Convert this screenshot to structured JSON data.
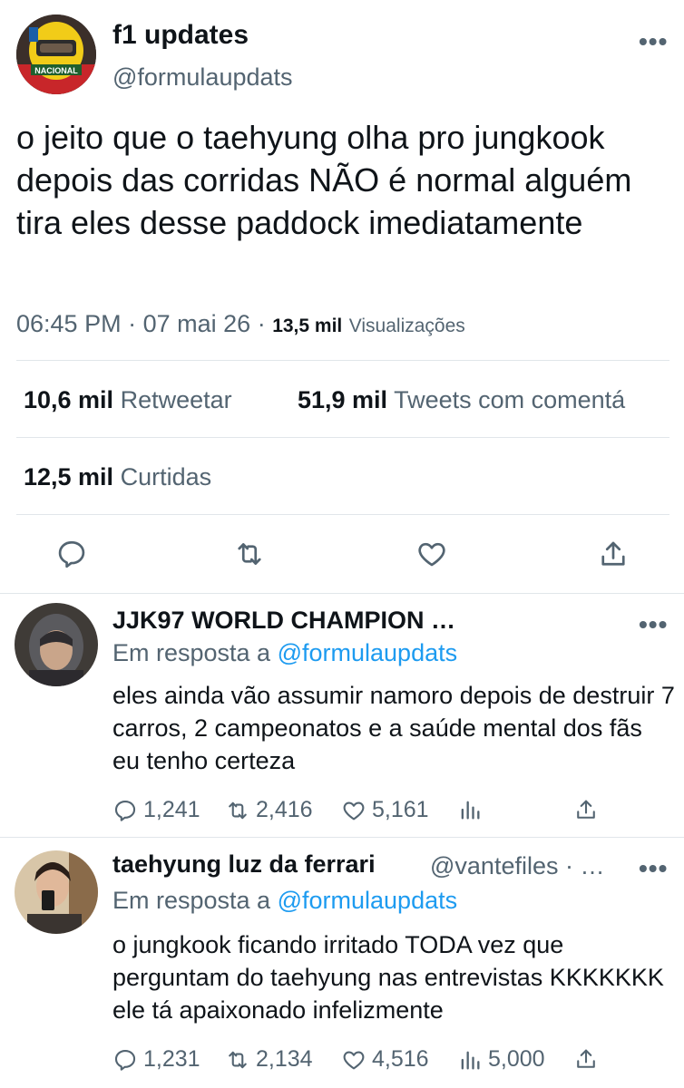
{
  "main_tweet": {
    "name": "f1 updates",
    "handle": "@formulaupdats",
    "text": "o jeito que o taehyung olha pro jungkook depois das corridas NÃO é normal alguém tira eles desse paddock imediatamente",
    "time": "06:45 PM",
    "date": "07 mai 26",
    "views_count": "13,5 mil",
    "views_label": "Visualizações",
    "retweets_count": "10,6 mil",
    "retweets_label": "Retweetar",
    "quotes_count": "51,9 mil",
    "quotes_label": "Tweets com comentá",
    "likes_count": "12,5 mil",
    "likes_label": "Curtidas",
    "avatar_badge": "NACIONAL",
    "icons": [
      "reply-icon",
      "retweet-icon",
      "like-icon",
      "share-icon"
    ]
  },
  "replies": [
    {
      "name": "JJK97 WORLD CHAMPION …",
      "handle": "",
      "in_reply_prefix": "Em resposta a",
      "in_reply_handle": "@formulaupdats",
      "text": "eles ainda vão assumir namoro depois de destruir 7 carros, 2 campeonatos e a saúde mental dos fãs eu tenho certeza",
      "reply_count": "1,241",
      "retweet_count": "2,416",
      "like_count": "5,161",
      "view_count": ""
    },
    {
      "name": "taehyung luz da ferrari",
      "handle": "@vantefiles · …",
      "in_reply_prefix": "Em resposta a",
      "in_reply_handle": "@formulaupdats",
      "text": "o jungkook ficando irritado TODA vez que perguntam do taehyung nas entrevistas KKKKKKK ele tá apaixonado infelizmente",
      "reply_count": "1,231",
      "retweet_count": "2,134",
      "like_count": "4,516",
      "view_count": "5,000"
    }
  ],
  "more_label": "•••",
  "colors": {
    "text": "#0f1419",
    "secondary": "#536471",
    "link": "#1d9bf0",
    "divider": "#e1e6ea"
  }
}
